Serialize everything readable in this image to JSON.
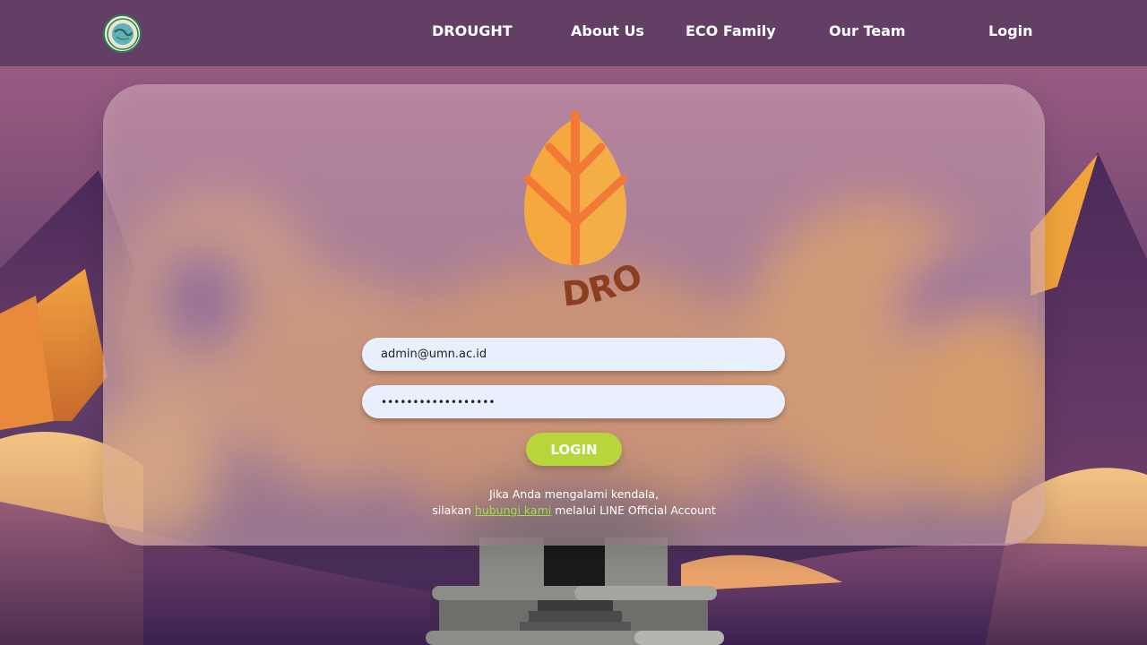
{
  "nav": {
    "logo_alt": "UMN ECO logo",
    "items": [
      {
        "label": "DROUGHT"
      },
      {
        "label": "About Us"
      },
      {
        "label": "ECO Family"
      },
      {
        "label": "Our Team"
      },
      {
        "label": "Login"
      }
    ]
  },
  "brand": {
    "name": "DROUGHT",
    "icon": "leaf-icon"
  },
  "form": {
    "email_value": "admin@umn.ac.id",
    "password_value": "••••••••••••••••••",
    "submit_label": "LOGIN"
  },
  "help": {
    "line1": "Jika Anda mengalami kendala,",
    "line2_prefix": "silakan ",
    "link_text": "hubungi kami",
    "line2_suffix": " melalui LINE Official Account"
  },
  "colors": {
    "nav_bg": "#633f66",
    "accent_green": "#b8d63b",
    "link_green": "#9ee04a",
    "brand_orange": "#f28a3a",
    "brand_text": "#8b3f1e"
  }
}
